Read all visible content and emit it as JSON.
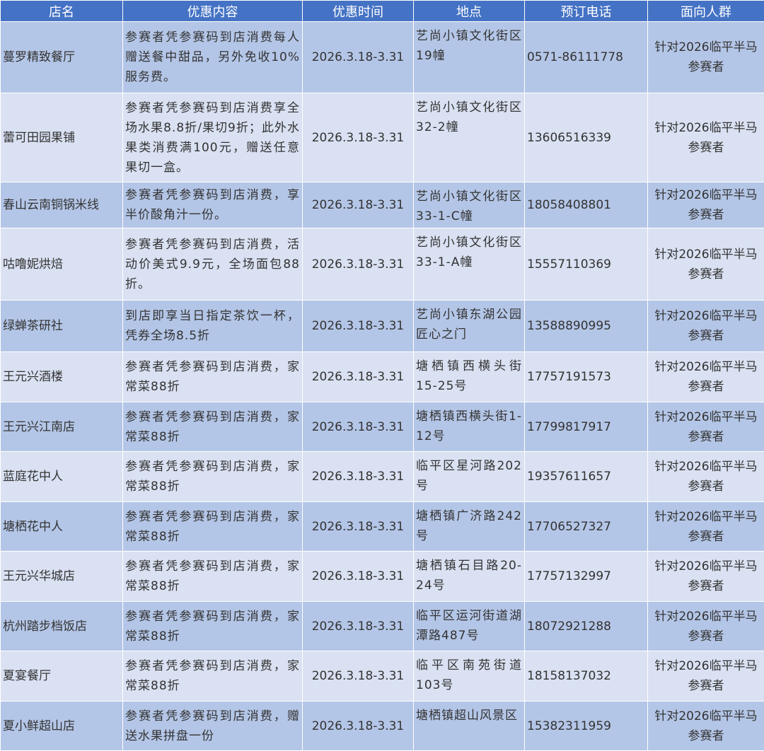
{
  "headers": [
    "店名",
    "优惠内容",
    "优惠时间",
    "地点",
    "预订电话",
    "面向人群"
  ],
  "rows": [
    {
      "name": "蔓罗精致餐厅",
      "offer": "参赛者凭参赛码到店消费每人赠送餐中甜品，另外免收10%服务费。",
      "period": "2026.3.18-3.31",
      "location": "艺尚小镇文化街区19幢",
      "phone": "0571-86111778",
      "audience": "针对2026临平半马参赛者"
    },
    {
      "name": "蕾可田园果铺",
      "offer": "参赛者凭参赛码到店消费享全场水果8.8折/果切9折；此外水果类消费满100元，赠送任意果切一盒。",
      "period": "2026.3.18-3.31",
      "location": "艺尚小镇文化街区32-2幢",
      "phone": "13606516339",
      "audience": "针对2026临平半马参赛者"
    },
    {
      "name": "春山云南铜锅米线",
      "offer": "参赛者凭参赛码到店消费，享半价酸角汁一份。",
      "period": "2026.3.18-3.31",
      "location": "艺尚小镇文化街区33-1-C幢",
      "phone": "18058408801",
      "audience": "针对2026临平半马参赛者"
    },
    {
      "name": "咕噜妮烘焙",
      "offer": "参赛者凭参赛码到店消费，活动价美式9.9元，全场面包88折。",
      "period": "2026.3.18-3.31",
      "location": "艺尚小镇文化街区33-1-A幢",
      "phone": "15557110369",
      "audience": "针对2026临平半马参赛者"
    },
    {
      "name": "绿蝉茶研社",
      "offer": "到店即享当日指定茶饮一杯，凭券全场8.5折",
      "period": "2026.3.18-3.31",
      "location": "艺尚小镇东湖公园匠心之门",
      "phone": "13588890995",
      "audience": "针对2026临平半马参赛者"
    },
    {
      "name": "王元兴酒楼",
      "offer": "参赛者凭参赛码到店消费，家常菜88折",
      "period": "2026.3.18-3.31",
      "location": "塘栖镇西横头街15-25号",
      "phone": "17757191573",
      "audience": "针对2026临平半马参赛者"
    },
    {
      "name": "王元兴江南店",
      "offer": "参赛者凭参赛码到店消费，家常菜88折",
      "period": "2026.3.18-3.31",
      "location": "塘栖镇西横头街1-12号",
      "phone": "17799817917",
      "audience": "针对2026临平半马参赛者"
    },
    {
      "name": "蓝庭花中人",
      "offer": "参赛者凭参赛码到店消费，家常菜88折",
      "period": "2026.3.18-3.31",
      "location": "临平区星河路202号",
      "phone": "19357611657",
      "audience": "针对2026临平半马参赛者"
    },
    {
      "name": "塘栖花中人",
      "offer": "参赛者凭参赛码到店消费，家常菜88折",
      "period": "2026.3.18-3.31",
      "location": "塘栖镇广济路242号",
      "phone": "17706527327",
      "audience": "针对2026临平半马参赛者"
    },
    {
      "name": "王元兴华城店",
      "offer": "参赛者凭参赛码到店消费，家常菜88折",
      "period": "2026.3.18-3.31",
      "location": "塘栖镇石目路20-24号",
      "phone": "17757132997",
      "audience": "针对2026临平半马参赛者"
    },
    {
      "name": "杭州踏步档饭店",
      "offer": "参赛者凭参赛码到店消费，家常菜88折",
      "period": "2026.3.18-3.31",
      "location": "临平区运河街道湖潭路487号",
      "phone": "18072921288",
      "audience": "针对2026临平半马参赛者"
    },
    {
      "name": "夏宴餐厅",
      "offer": "参赛者凭参赛码到店消费，家常菜88折",
      "period": "2026.3.18-3.31",
      "location": "临平区南苑街道103号",
      "phone": "18158137032",
      "audience": "针对2026临平半马参赛者"
    },
    {
      "name": "夏小鲜超山店",
      "offer": "参赛者凭参赛码到店消费，赠送水果拼盘一份",
      "period": "2026.3.18-3.31",
      "location": "塘栖镇超山风景区",
      "phone": "15382311959",
      "audience": "针对2026临平半马参赛者"
    }
  ]
}
